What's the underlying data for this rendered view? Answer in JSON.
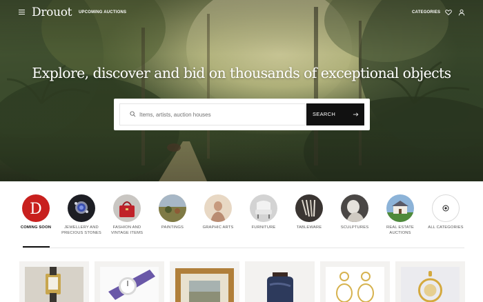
{
  "header": {
    "logo": "Drouot",
    "upcoming_label": "UPCOMING AUCTIONS",
    "categories_label": "CATEGORIES"
  },
  "hero": {
    "headline": "Explore, discover and bid on thousands of exceptional objects"
  },
  "search": {
    "placeholder": "Items, artists, auction houses",
    "value": "",
    "button_label": "SEARCH"
  },
  "categories": [
    {
      "label": "COMING SOON",
      "active": true,
      "icon": "drouot-d-logo"
    },
    {
      "label": "JEWELLERY AND PRECIOUS STONES",
      "active": false,
      "icon": "jewellery-photo"
    },
    {
      "label": "FASHION AND VINTAGE ITEMS",
      "active": false,
      "icon": "handbag-photo"
    },
    {
      "label": "PAINTINGS",
      "active": false,
      "icon": "painting-photo"
    },
    {
      "label": "GRAPHIC ARTS",
      "active": false,
      "icon": "drawing-photo"
    },
    {
      "label": "FURNITURE",
      "active": false,
      "icon": "armchair-photo"
    },
    {
      "label": "TABLEWARE",
      "active": false,
      "icon": "cutlery-photo"
    },
    {
      "label": "SCULPTURES",
      "active": false,
      "icon": "sculpture-photo"
    },
    {
      "label": "REAL ESTATE AUCTIONS",
      "active": false,
      "icon": "house-photo"
    },
    {
      "label": "ALL CATEGORIES",
      "active": false,
      "icon": "target-icon"
    }
  ],
  "colors": {
    "accent_red": "#c8201e",
    "search_button": "#111111",
    "active_underline": "#111111"
  }
}
